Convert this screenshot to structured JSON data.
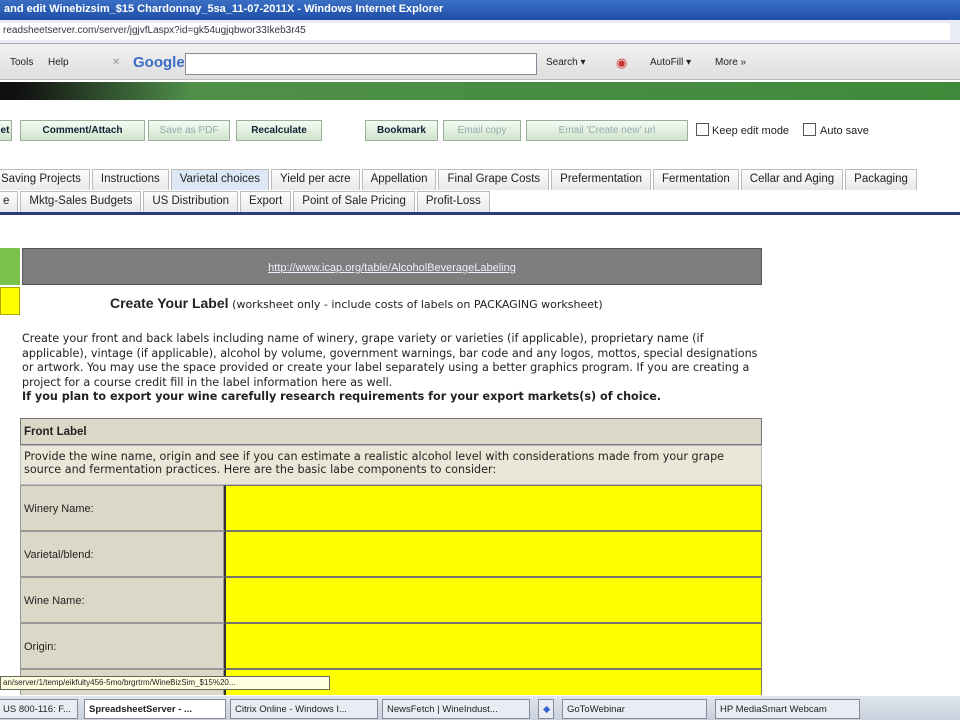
{
  "window": {
    "title": "and edit Winebizsim_$15 Chardonnay_5sa_11-07-2011X - Windows Internet Explorer",
    "url": "readsheetserver.com/server/jgjvfLaspx?id=gk54ugjqbwor33Ikeb3r45"
  },
  "toolbar": {
    "tools": "Tools",
    "help": "Help",
    "close": "✕",
    "google": "Google",
    "search": "Search ▾",
    "autofill": "AutoFill ▾",
    "more": "More »"
  },
  "actions": {
    "et": "et",
    "comment": "Comment/Attach",
    "save_pdf": "Save as PDF",
    "recalc": "Recalculate",
    "bookmark": "Bookmark",
    "email_copy": "Email copy",
    "email_create": "Email 'Create new' url",
    "keep_edit": "Keep edit mode",
    "auto_save": "Auto save"
  },
  "tabs_row1": [
    "Saving Projects",
    "Instructions",
    "Varietal choices",
    "Yield per acre",
    "Appellation",
    "Final Grape Costs",
    "Prefermentation",
    "Fermentation",
    "Cellar and Aging",
    "Packaging"
  ],
  "tabs_row2": [
    "e",
    "Mktg-Sales Budgets",
    "US Distribution",
    "Export",
    "Point of Sale Pricing",
    "Profit-Loss"
  ],
  "content": {
    "link": "http://www.icap.org/table/AlcoholBeverageLabeling",
    "heading": "Create Your Label",
    "heading_note": "(worksheet only - include costs of labels on PACKAGING worksheet)",
    "para": "Create your front and back labels including name of winery, grape variety or varieties (if applicable), proprietary name (if applicable), vintage (if applicable), alcohol by volume, government warnings, bar code and any logos, mottos, special designations or artwork. You may use the space provided or create your label separately using a better graphics program. If you are creating a project for a course credit fill in the label information here as well.",
    "para_bold": "If you plan to export your wine carefully research requirements for your export markets(s) of choice.",
    "front_label": "Front Label",
    "front_desc": "Provide the wine name, origin and see if you can estimate a realistic alcohol level with considerations made from your grape source and fermentation practices. Here are the basic labe components to consider:",
    "fields": [
      {
        "label": "Winery Name:",
        "value": ""
      },
      {
        "label": "Varietal/blend:",
        "value": ""
      },
      {
        "label": "Wine Name:",
        "value": ""
      },
      {
        "label": "Origin:",
        "value": ""
      }
    ]
  },
  "status": "an/server/1/temp/eikfulty456-5mo/brgrtrm/WineBizSim_$15%20...",
  "taskbar": [
    "US 800-116: F...",
    "SpreadsheetServer - ...",
    "Citrix Online - Windows I...",
    "NewsFetch | WineIndust...",
    "GoToWebinar",
    "HP MediaSmart Webcam"
  ]
}
